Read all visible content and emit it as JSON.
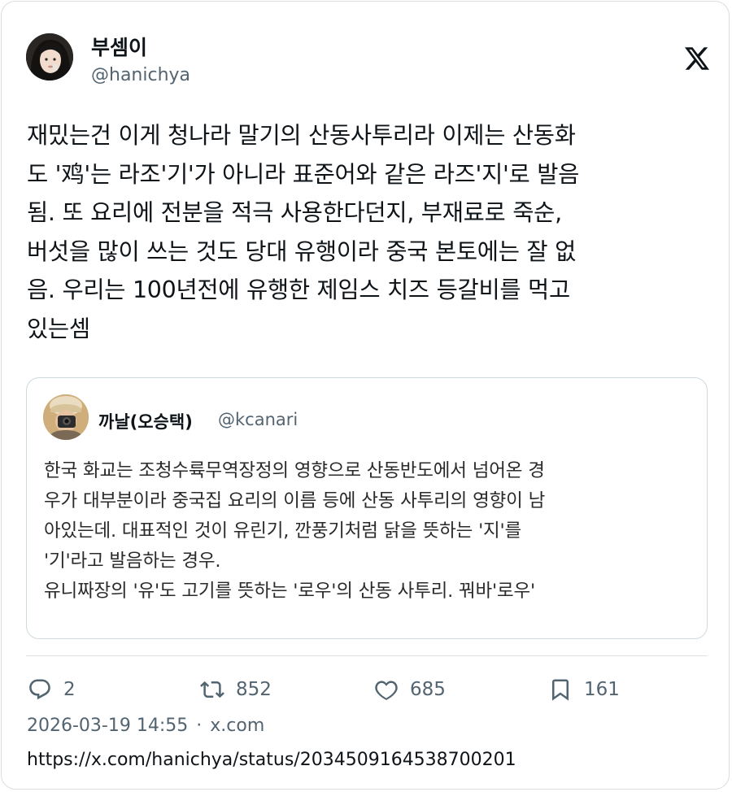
{
  "author": {
    "display_name": "부셈이",
    "handle": "@hanichya"
  },
  "tweet": {
    "text": "재밌는건 이게 청나라 말기의 산동사투리라 이제는 산동화\n도 '鸡'는 라조'기'가 아니라 표준어와 같은 라즈'지'로 발음\n됨. 또 요리에 전분을 적극 사용한다던지, 부재료로 죽순,\n버섯을 많이 쓰는 것도 당대 유행이라 중국 본토에는 잘 없\n음. 우리는 100년전에 유행한 제임스 치즈 등갈비를 먹고\n있는셈"
  },
  "quote": {
    "display_name": "까날(오승택)",
    "handle": "@kcanari",
    "text": "한국 화교는 조청수륙무역장정의 영향으로 산동반도에서 넘어온 경\n우가 대부분이라 중국집 요리의 이름 등에 산동 사투리의 영향이 남\n아있는데. 대표적인 것이 유린기, 깐풍기처럼 닭을 뜻하는 '지'를\n'기'라고 발음하는 경우.\n유니짜장의 '유'도 고기를 뜻하는 '로우'의 산동 사투리. 꿔바'로우'"
  },
  "actions": {
    "reply_count": "2",
    "repost_count": "852",
    "like_count": "685",
    "bookmark_count": "161"
  },
  "meta": {
    "timestamp": "2026-03-19 14:55",
    "separator": "·",
    "source": "x.com"
  },
  "url": "https://x.com/hanichya/status/2034509164538700201",
  "icons": {
    "brand": "x-logo-icon",
    "reply": "reply-icon",
    "repost": "repost-icon",
    "like": "heart-icon",
    "bookmark": "bookmark-icon"
  },
  "colors": {
    "text": "#0f1419",
    "secondary": "#536471",
    "border": "#cfd9de"
  }
}
